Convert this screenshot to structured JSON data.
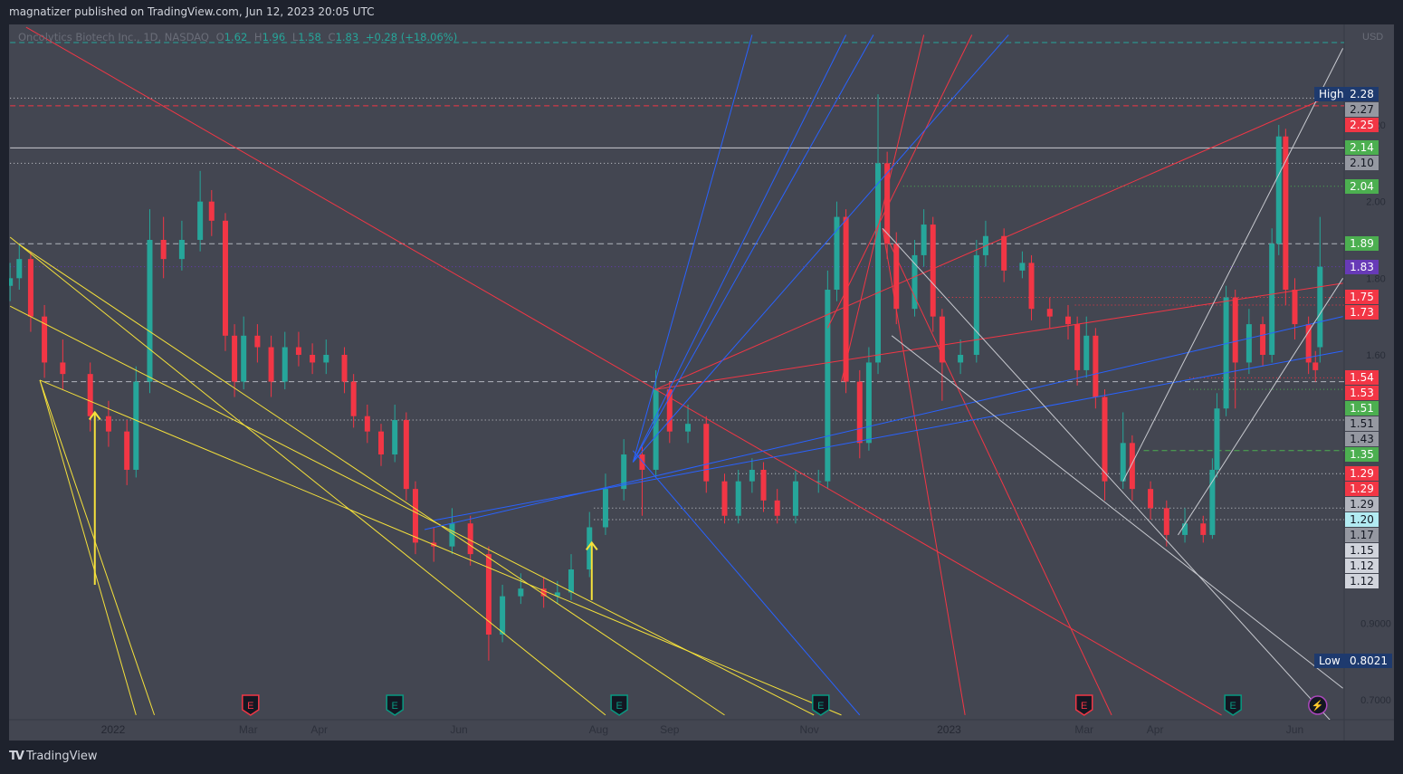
{
  "header": {
    "published": "magnatizer published on TradingView.com, Jun 12, 2023 20:05 UTC"
  },
  "legend": {
    "symbol": "Oncolytics Biotech Inc., 1D, NASDAQ",
    "o_label": "O",
    "open": "1.62",
    "h_label": "H",
    "high": "1.96",
    "l_label": "L",
    "low": "1.58",
    "c_label": "C",
    "close": "1.83",
    "change": "+0.28 (+18.06%)"
  },
  "brand": {
    "name": "TradingView"
  },
  "colors": {
    "up": "#26a69a",
    "down": "#f23645",
    "bg": "#434651",
    "yellow": "#f5e13b",
    "red": "#f23645",
    "blue": "#2962ff",
    "white": "#c8cad0"
  },
  "chart_data": {
    "type": "candlestick",
    "title": "Oncolytics Biotech Inc., 1D, NASDAQ",
    "currency": "USD",
    "day_origin": "2022-01-01",
    "candle_format": [
      "day",
      "open",
      "high",
      "low",
      "close"
    ],
    "candles": [
      [
        -45,
        1.78,
        1.84,
        1.74,
        1.8
      ],
      [
        -41,
        1.8,
        1.89,
        1.77,
        1.85
      ],
      [
        -36,
        1.85,
        1.87,
        1.66,
        1.7
      ],
      [
        -30,
        1.7,
        1.73,
        1.54,
        1.58
      ],
      [
        -22,
        1.58,
        1.64,
        1.51,
        1.55
      ],
      [
        -10,
        1.55,
        1.58,
        1.4,
        1.44
      ],
      [
        -2,
        1.44,
        1.48,
        1.36,
        1.4
      ],
      [
        6,
        1.4,
        1.43,
        1.26,
        1.3
      ],
      [
        10,
        1.3,
        1.57,
        1.28,
        1.53
      ],
      [
        16,
        1.53,
        1.98,
        1.5,
        1.9
      ],
      [
        22,
        1.9,
        1.96,
        1.8,
        1.85
      ],
      [
        30,
        1.85,
        1.95,
        1.82,
        1.9
      ],
      [
        38,
        1.9,
        2.08,
        1.87,
        2.0
      ],
      [
        43,
        2.0,
        2.03,
        1.91,
        1.95
      ],
      [
        49,
        1.95,
        1.97,
        1.61,
        1.65
      ],
      [
        53,
        1.65,
        1.68,
        1.49,
        1.53
      ],
      [
        57,
        1.53,
        1.7,
        1.51,
        1.65
      ],
      [
        63,
        1.65,
        1.68,
        1.58,
        1.62
      ],
      [
        69,
        1.62,
        1.65,
        1.49,
        1.53
      ],
      [
        75,
        1.53,
        1.66,
        1.51,
        1.62
      ],
      [
        81,
        1.62,
        1.66,
        1.57,
        1.6
      ],
      [
        87,
        1.6,
        1.63,
        1.55,
        1.58
      ],
      [
        93,
        1.58,
        1.64,
        1.55,
        1.6
      ],
      [
        101,
        1.6,
        1.62,
        1.5,
        1.53
      ],
      [
        105,
        1.53,
        1.55,
        1.41,
        1.44
      ],
      [
        111,
        1.44,
        1.47,
        1.37,
        1.4
      ],
      [
        117,
        1.4,
        1.42,
        1.31,
        1.34
      ],
      [
        123,
        1.34,
        1.47,
        1.32,
        1.43
      ],
      [
        128,
        1.43,
        1.45,
        1.22,
        1.25
      ],
      [
        132,
        1.25,
        1.27,
        1.08,
        1.11
      ],
      [
        140,
        1.11,
        1.15,
        1.06,
        1.1
      ],
      [
        148,
        1.1,
        1.2,
        1.08,
        1.16
      ],
      [
        156,
        1.16,
        1.18,
        1.05,
        1.08
      ],
      [
        164,
        1.08,
        1.1,
        0.8021,
        0.87
      ],
      [
        170,
        0.87,
        1.0,
        0.85,
        0.97
      ],
      [
        178,
        0.97,
        1.03,
        0.95,
        0.99
      ],
      [
        188,
        0.99,
        1.02,
        0.94,
        0.97
      ],
      [
        194,
        0.97,
        1.01,
        0.95,
        0.98
      ],
      [
        200,
        0.98,
        1.08,
        0.96,
        1.04
      ],
      [
        208,
        1.04,
        1.19,
        1.02,
        1.15
      ],
      [
        215,
        1.15,
        1.29,
        1.13,
        1.25
      ],
      [
        223,
        1.25,
        1.38,
        1.22,
        1.34
      ],
      [
        231,
        1.34,
        1.36,
        1.18,
        1.3
      ],
      [
        237,
        1.3,
        1.56,
        1.28,
        1.51
      ],
      [
        243,
        1.51,
        1.53,
        1.37,
        1.4
      ],
      [
        251,
        1.4,
        1.47,
        1.37,
        1.42
      ],
      [
        259,
        1.42,
        1.44,
        1.24,
        1.27
      ],
      [
        267,
        1.27,
        1.29,
        1.16,
        1.18
      ],
      [
        273,
        1.18,
        1.3,
        1.16,
        1.27
      ],
      [
        279,
        1.27,
        1.33,
        1.24,
        1.3
      ],
      [
        284,
        1.3,
        1.32,
        1.19,
        1.22
      ],
      [
        290,
        1.22,
        1.25,
        1.16,
        1.18
      ],
      [
        298,
        1.18,
        1.3,
        1.16,
        1.27
      ],
      [
        308,
        1.27,
        1.3,
        1.24,
        1.27
      ],
      [
        312,
        1.27,
        1.82,
        1.25,
        1.77
      ],
      [
        316,
        1.77,
        2.0,
        1.74,
        1.96
      ],
      [
        320,
        1.96,
        1.98,
        1.5,
        1.53
      ],
      [
        326,
        1.53,
        1.56,
        1.33,
        1.37
      ],
      [
        330,
        1.37,
        1.62,
        1.35,
        1.58
      ],
      [
        334,
        1.58,
        2.28,
        1.55,
        2.1
      ],
      [
        338,
        2.1,
        2.13,
        1.85,
        1.89
      ],
      [
        342,
        1.89,
        1.92,
        1.68,
        1.72
      ],
      [
        350,
        1.72,
        1.9,
        1.7,
        1.86
      ],
      [
        354,
        1.86,
        1.98,
        1.83,
        1.94
      ],
      [
        358,
        1.94,
        1.96,
        1.66,
        1.7
      ],
      [
        362,
        1.7,
        1.72,
        1.48,
        1.58
      ],
      [
        370,
        1.58,
        1.64,
        1.55,
        1.6
      ],
      [
        377,
        1.6,
        1.9,
        1.58,
        1.86
      ],
      [
        381,
        1.86,
        1.95,
        1.83,
        1.91
      ],
      [
        389,
        1.91,
        1.93,
        1.79,
        1.82
      ],
      [
        397,
        1.82,
        1.87,
        1.8,
        1.84
      ],
      [
        401,
        1.84,
        1.86,
        1.69,
        1.72
      ],
      [
        409,
        1.72,
        1.75,
        1.67,
        1.7
      ],
      [
        417,
        1.7,
        1.73,
        1.64,
        1.68
      ],
      [
        421,
        1.68,
        1.7,
        1.52,
        1.56
      ],
      [
        425,
        1.56,
        1.7,
        1.54,
        1.65
      ],
      [
        429,
        1.65,
        1.67,
        1.46,
        1.49
      ],
      [
        433,
        1.49,
        1.51,
        1.22,
        1.27
      ],
      [
        441,
        1.27,
        1.45,
        1.25,
        1.37
      ],
      [
        445,
        1.37,
        1.39,
        1.22,
        1.25
      ],
      [
        453,
        1.25,
        1.27,
        1.17,
        1.2
      ],
      [
        460,
        1.2,
        1.22,
        1.1,
        1.13
      ],
      [
        468,
        1.13,
        1.2,
        1.11,
        1.16
      ],
      [
        476,
        1.16,
        1.18,
        1.11,
        1.13
      ],
      [
        480,
        1.13,
        1.33,
        1.12,
        1.3
      ],
      [
        482,
        1.3,
        1.5,
        1.28,
        1.46
      ],
      [
        486,
        1.46,
        1.78,
        1.44,
        1.75
      ],
      [
        490,
        1.75,
        1.77,
        1.46,
        1.58
      ],
      [
        496,
        1.58,
        1.72,
        1.55,
        1.68
      ],
      [
        502,
        1.68,
        1.7,
        1.57,
        1.6
      ],
      [
        506,
        1.6,
        1.93,
        1.58,
        1.89
      ],
      [
        509,
        1.89,
        2.2,
        1.86,
        2.17
      ],
      [
        512,
        2.17,
        2.19,
        1.73,
        1.77
      ],
      [
        516,
        1.77,
        1.8,
        1.64,
        1.68
      ],
      [
        522,
        1.68,
        1.7,
        1.55,
        1.58
      ],
      [
        525,
        1.58,
        1.61,
        1.53,
        1.56
      ],
      [
        527,
        1.62,
        1.96,
        1.58,
        1.83
      ]
    ],
    "price_ticks": [
      "2.20",
      "2.00",
      "1.80",
      "1.60",
      "0.9000",
      "0.7000"
    ],
    "time_labels": [
      {
        "day": 0,
        "label": "2022",
        "bold": true
      },
      {
        "day": 59,
        "label": "Mar"
      },
      {
        "day": 90,
        "label": "Apr"
      },
      {
        "day": 151,
        "label": "Jun"
      },
      {
        "day": 212,
        "label": "Aug"
      },
      {
        "day": 243,
        "label": "Sep"
      },
      {
        "day": 304,
        "label": "Nov"
      },
      {
        "day": 365,
        "label": "2023",
        "bold": true
      },
      {
        "day": 424,
        "label": "Mar"
      },
      {
        "day": 455,
        "label": "Apr"
      },
      {
        "day": 516,
        "label": "Jun"
      }
    ],
    "high": {
      "tag": "High",
      "value": "2.28"
    },
    "low": {
      "tag": "Low",
      "value": "0.8021"
    },
    "price_labels": [
      {
        "text": "2.28",
        "bg": "#1e3a6e",
        "fg": "#ffffff"
      },
      {
        "text": "2.27",
        "bg": "#9598a1",
        "fg": "#131722"
      },
      {
        "text": "2.25",
        "bg": "#f23645",
        "fg": "#ffffff"
      },
      {
        "text": "2.14",
        "bg": "#4caf50",
        "fg": "#ffffff"
      },
      {
        "text": "2.10",
        "bg": "#9598a1",
        "fg": "#131722"
      },
      {
        "text": "2.04",
        "bg": "#4caf50",
        "fg": "#ffffff"
      },
      {
        "text": "1.89",
        "bg": "#4caf50",
        "fg": "#ffffff"
      },
      {
        "text": "1.83",
        "bg": "#673ab7",
        "fg": "#ffffff"
      },
      {
        "text": "1.75",
        "bg": "#f23645",
        "fg": "#ffffff"
      },
      {
        "text": "1.73",
        "bg": "#f23645",
        "fg": "#ffffff"
      },
      {
        "text": "1.54",
        "bg": "#f23645",
        "fg": "#ffffff"
      },
      {
        "text": "1.53",
        "bg": "#f23645",
        "fg": "#ffffff"
      },
      {
        "text": "1.51",
        "bg": "#4caf50",
        "fg": "#ffffff"
      },
      {
        "text": "1.51",
        "bg": "#9598a1",
        "fg": "#131722"
      },
      {
        "text": "1.43",
        "bg": "#9598a1",
        "fg": "#131722"
      },
      {
        "text": "1.35",
        "bg": "#4caf50",
        "fg": "#ffffff"
      },
      {
        "text": "1.29",
        "bg": "#f23645",
        "fg": "#ffffff"
      },
      {
        "text": "1.29",
        "bg": "#f23645",
        "fg": "#ffffff"
      },
      {
        "text": "1.29",
        "bg": "#b2b5be",
        "fg": "#131722"
      },
      {
        "text": "1.20",
        "bg": "#b2ebf2",
        "fg": "#131722"
      },
      {
        "text": "1.17",
        "bg": "#9598a1",
        "fg": "#131722"
      },
      {
        "text": "1.15",
        "bg": "#d1d4dc",
        "fg": "#131722"
      },
      {
        "text": "1.12",
        "bg": "#d1d4dc",
        "fg": "#131722"
      },
      {
        "text": "1.12",
        "bg": "#d1d4dc",
        "fg": "#131722"
      }
    ],
    "hlines": [
      {
        "price": 2.415,
        "from": -45,
        "color": "#26a69a",
        "dash": "6,4"
      },
      {
        "price": 2.27,
        "from": -45,
        "color": "#c8cad0",
        "dash": "1,3"
      },
      {
        "price": 2.25,
        "from": -45,
        "color": "#f23645",
        "dash": "6,4"
      },
      {
        "price": 2.14,
        "from": -45,
        "color": "#c8cad0",
        "dash": "none"
      },
      {
        "price": 2.1,
        "from": -45,
        "color": "#c8cad0",
        "dash": "1,3"
      },
      {
        "price": 2.04,
        "from": 345,
        "color": "#4caf50",
        "dash": "1,3"
      },
      {
        "price": 1.89,
        "from": -45,
        "color": "#b2b5be",
        "dash": "6,4"
      },
      {
        "price": 1.83,
        "from": -45,
        "color": "#673ab7",
        "dash": "1,3"
      },
      {
        "price": 1.75,
        "from": 360,
        "color": "#f23645",
        "dash": "1,3"
      },
      {
        "price": 1.73,
        "from": 420,
        "color": "#f23645",
        "dash": "1,3"
      },
      {
        "price": 1.54,
        "from": 470,
        "color": "#f23645",
        "dash": "1,3"
      },
      {
        "price": 1.53,
        "from": -30,
        "color": "#b2b5be",
        "dash": "6,4"
      },
      {
        "price": 1.51,
        "from": 470,
        "color": "#4caf50",
        "dash": "1,3"
      },
      {
        "price": 1.43,
        "from": -10,
        "color": "#c8cad0",
        "dash": "1,3"
      },
      {
        "price": 1.35,
        "from": 450,
        "color": "#4caf50",
        "dash": "6,4"
      },
      {
        "price": 1.29,
        "from": 270,
        "color": "#c8cad0",
        "dash": "1,3"
      },
      {
        "price": 1.2,
        "from": 210,
        "color": "#c8cad0",
        "dash": "1,3"
      },
      {
        "price": 1.17,
        "from": 210,
        "color": "#c8cad0",
        "dash": "1,3"
      }
    ],
    "trendlines": [
      {
        "color": "#f5e13b",
        "p1": [
          -45,
          1.907
        ],
        "p2": [
          215,
          0.66
        ]
      },
      {
        "color": "#f5e13b",
        "p1": [
          -45,
          1.727
        ],
        "p2": [
          306,
          0.66
        ]
      },
      {
        "color": "#f5e13b",
        "p1": [
          -41,
          1.888
        ],
        "p2": [
          267,
          0.66
        ]
      },
      {
        "color": "#f5e13b",
        "p1": [
          -32,
          1.534
        ],
        "p2": [
          318,
          0.66
        ]
      },
      {
        "color": "#f5e13b",
        "p1": [
          -32,
          1.534
        ],
        "p2": [
          18,
          0.66
        ]
      },
      {
        "color": "#f5e13b",
        "p1": [
          -32,
          1.534
        ],
        "p2": [
          10,
          0.66
        ]
      },
      {
        "color": "#f23645",
        "p1": [
          -38,
          2.455
        ],
        "p2": [
          484,
          0.66
        ]
      },
      {
        "color": "#f23645",
        "p1": [
          237,
          1.51
        ],
        "p2": [
          537,
          1.787
        ]
      },
      {
        "color": "#f23645",
        "p1": [
          237,
          1.51
        ],
        "p2": [
          537,
          2.29
        ]
      },
      {
        "color": "#f23645",
        "p1": [
          312,
          1.67
        ],
        "p2": [
          375,
          2.435
        ]
      },
      {
        "color": "#f23645",
        "p1": [
          336,
          1.93
        ],
        "p2": [
          372,
          0.66
        ]
      },
      {
        "color": "#f23645",
        "p1": [
          336,
          1.93
        ],
        "p2": [
          436,
          0.66
        ]
      },
      {
        "color": "#f23645",
        "p1": [
          318,
          1.53
        ],
        "p2": [
          354,
          2.435
        ]
      },
      {
        "color": "#2962ff",
        "p1": [
          140,
          1.168
        ],
        "p2": [
          537,
          1.61
        ]
      },
      {
        "color": "#2962ff",
        "p1": [
          136,
          1.144
        ],
        "p2": [
          537,
          1.7
        ]
      },
      {
        "color": "#2962ff",
        "p1": [
          227,
          1.32
        ],
        "p2": [
          279,
          2.435
        ]
      },
      {
        "color": "#2962ff",
        "p1": [
          227,
          1.32
        ],
        "p2": [
          320,
          2.435
        ]
      },
      {
        "color": "#2962ff",
        "p1": [
          227,
          1.32
        ],
        "p2": [
          332,
          2.435
        ]
      },
      {
        "color": "#2962ff",
        "p1": [
          227,
          1.32
        ],
        "p2": [
          391,
          2.435
        ]
      },
      {
        "color": "#2962ff",
        "p1": [
          227,
          1.35
        ],
        "p2": [
          326,
          0.66
        ]
      },
      {
        "color": "#c8cad0",
        "p1": [
          336,
          1.93
        ],
        "p2": [
          537,
          0.61
        ]
      },
      {
        "color": "#c8cad0",
        "p1": [
          340,
          1.65
        ],
        "p2": [
          537,
          0.73
        ]
      },
      {
        "color": "#c8cad0",
        "p1": [
          441,
          1.27
        ],
        "p2": [
          537,
          2.4
        ]
      },
      {
        "color": "#c8cad0",
        "p1": [
          465,
          1.13
        ],
        "p2": [
          537,
          1.8
        ]
      }
    ],
    "arrows": [
      {
        "day": -8,
        "from": 1.0,
        "to": 1.45,
        "color": "#f5e13b"
      },
      {
        "day": 209,
        "from": 0.96,
        "to": 1.11,
        "color": "#f5e13b"
      }
    ],
    "events": [
      {
        "day": 60,
        "type": "earnings",
        "label": "E",
        "color": "#f23645"
      },
      {
        "day": 123,
        "type": "earnings",
        "label": "E",
        "color": "#089981"
      },
      {
        "day": 221,
        "type": "earnings",
        "label": "E",
        "color": "#089981"
      },
      {
        "day": 309,
        "type": "earnings",
        "label": "E",
        "color": "#089981"
      },
      {
        "day": 424,
        "type": "earnings",
        "label": "E",
        "color": "#f23645"
      },
      {
        "day": 489,
        "type": "earnings",
        "label": "E",
        "color": "#089981"
      },
      {
        "day": 526,
        "type": "split-dividend",
        "label": "⚡",
        "color": "#ab47bc"
      }
    ]
  }
}
